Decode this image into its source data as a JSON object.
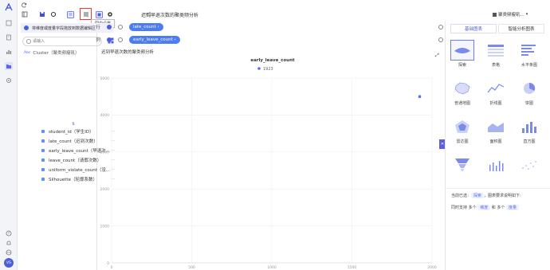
{
  "toolbar": {
    "title": "迟到早退次数的聚类频分析",
    "tooltip": "图内设置",
    "dataset_label": "聚类频瘦吼..."
  },
  "left_panel": {
    "tip": "将维度或度量字段拖放到数据编辑区",
    "search_placeholder": "请输入",
    "cluster_label": "Cluster（聚类频瘦吼）",
    "fields": [
      "student_id（学生ID）",
      "late_count（迟到次数）",
      "early_leave_count（早退次...",
      "leave_count（请假次数）",
      "uniform_violate_count（没...",
      "Silhouette（轮廓系数）"
    ],
    "more": "···"
  },
  "shelves": {
    "row_label": "行",
    "col_label": "列",
    "row_pill": "late_count ›",
    "col_pill": "early_leave_count ›"
  },
  "chart_header": "迟到早退次数的聚类频分析",
  "chart_data": {
    "type": "scatter",
    "title": "early_leave_count",
    "legend": [
      "1923"
    ],
    "series": [
      {
        "name": "1923",
        "points": [
          {
            "x": 1923,
            "y": 4500
          }
        ]
      }
    ],
    "x_ticks": [
      0,
      500,
      1000,
      1500,
      2000
    ],
    "y_ticks": [
      0,
      1000,
      2000,
      3000,
      4000,
      5000
    ],
    "xlim": [
      0,
      2000
    ],
    "ylim": [
      0,
      5000
    ],
    "grid": true,
    "legend_position": "top-center",
    "color": "#5b6cf5"
  },
  "right_panel": {
    "tabs": [
      "基础图表",
      "智能分析图表"
    ],
    "charts": [
      {
        "label": "探索",
        "icon": "explore-icon"
      },
      {
        "label": "表格",
        "icon": "table-icon"
      },
      {
        "label": "水平条图",
        "icon": "horizontal-bar-icon"
      },
      {
        "label": "普通地图",
        "icon": "map-icon"
      },
      {
        "label": "折线图",
        "icon": "line-chart-icon"
      },
      {
        "label": "饼图",
        "icon": "pie-chart-icon"
      },
      {
        "label": "雷达图",
        "icon": "radar-icon"
      },
      {
        "label": "面积图",
        "icon": "area-chart-icon"
      },
      {
        "label": "直方图",
        "icon": "histogram-icon"
      },
      {
        "label": "",
        "icon": "funnel-icon"
      },
      {
        "label": "",
        "icon": "bar-small-icon"
      },
      {
        "label": "",
        "icon": "scatter-icon"
      }
    ],
    "info_line1_a": "当前已选：",
    "info_line1_tag": "探索",
    "info_line1_b": "，图表要求说明如下:",
    "info_line2_a": "同时支持 多个",
    "info_line2_tag1": "维度",
    "info_line2_b": "和 多个",
    "info_line2_tag2": "度量"
  },
  "sidebar_user": "VS"
}
